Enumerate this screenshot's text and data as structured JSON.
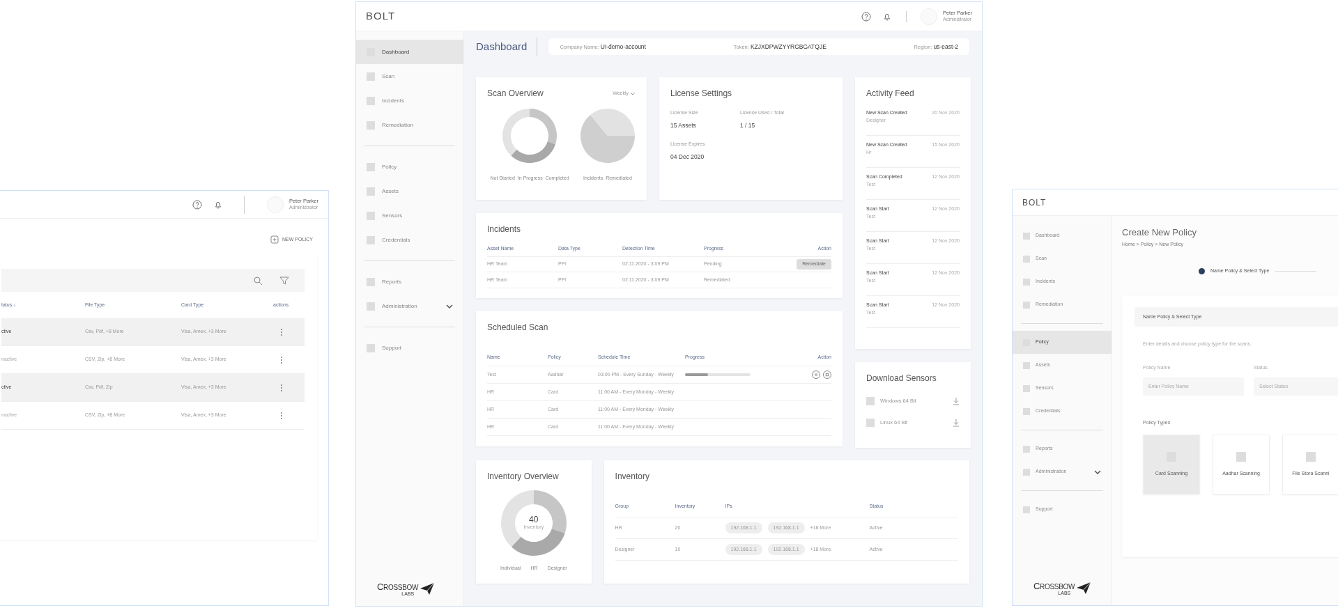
{
  "policy_list_screen": {
    "user": {
      "name": "Peter Parker",
      "role": "Administrator"
    },
    "new_policy_button": "NEW POLICY",
    "table": {
      "columns": [
        "tatus ↓",
        "File Type",
        "Card Type",
        "actions"
      ],
      "rows": [
        {
          "cells": [
            "ctive",
            "Csv, Pdf, +8 More",
            "Visa, Amex, +3 More"
          ],
          "highlighted": true
        },
        {
          "cells": [
            "nactive",
            "CSV, Zip, +8 More",
            "Visa, Amex, +3 More"
          ],
          "highlighted": false
        },
        {
          "cells": [
            "ctive",
            "Csv, Pdf, Zip",
            "Visa, Amex, +3 More"
          ],
          "highlighted": true
        },
        {
          "cells": [
            "nactive",
            "CSV, Zip, +8 More",
            "Visa, Amex, +3 More"
          ],
          "highlighted": false
        }
      ]
    }
  },
  "dashboard_screen": {
    "brand": "BOLT",
    "user": {
      "name": "Peter Parker",
      "role": "Administrator"
    },
    "sidebar": {
      "groups": [
        [
          {
            "label": "Dashboard",
            "selected": true,
            "kind": "link"
          },
          {
            "label": "Scan",
            "selected": false,
            "kind": "link"
          },
          {
            "label": "Incidents",
            "selected": false,
            "kind": "link"
          },
          {
            "label": "Remediation",
            "selected": false,
            "kind": "link"
          }
        ],
        [
          {
            "label": "Policy",
            "selected": false,
            "kind": "link"
          },
          {
            "label": "Assets",
            "selected": false,
            "kind": "link"
          },
          {
            "label": "Sensors",
            "selected": false,
            "kind": "link"
          },
          {
            "label": "Credentials",
            "selected": false,
            "kind": "link"
          }
        ],
        [
          {
            "label": "Reports",
            "selected": false,
            "kind": "link"
          },
          {
            "label": "Administration",
            "selected": false,
            "kind": "submenu"
          }
        ],
        [
          {
            "label": "Support",
            "selected": false,
            "kind": "link"
          }
        ]
      ]
    },
    "logo": {
      "name": "CROSSBOW",
      "sub": "LABS"
    },
    "page_title": "Dashboard",
    "info": [
      "Company Name: **UI-demo-account**",
      "Token: **KZJXDPWZYYRGBGATQJE**",
      "Region: **us-east-2**"
    ],
    "scan_overview": {
      "title": "Scan Overview",
      "period": "Weekly",
      "donut_legend": [
        "Not Started",
        "In Progress",
        "Completed"
      ],
      "pie_legend": [
        "Incidents",
        "Remediated"
      ]
    },
    "license_settings": {
      "title": "License Settings",
      "fields": [
        {
          "label": "License Size",
          "value": "15 Assets"
        },
        {
          "label": "License Used / Total",
          "value": "1 / 15"
        },
        {
          "label": "License Expires",
          "value": "04 Dec 2020"
        }
      ]
    },
    "activity_feed": {
      "title": "Activity Feed",
      "items": [
        {
          "title": "New Scan Created",
          "subtitle": "Designer",
          "date": "20 Nov 2020"
        },
        {
          "title": "New Scan Created",
          "subtitle": "Hr",
          "date": "15 Nov 2020"
        },
        {
          "title": "Scan Completed",
          "subtitle": "Test",
          "date": "12 Nov 2020"
        },
        {
          "title": "Scan Start",
          "subtitle": "Test",
          "date": "12 Nov 2020"
        },
        {
          "title": "Scan Start",
          "subtitle": "Test",
          "date": "12 Nov 2020"
        },
        {
          "title": "Scan Start",
          "subtitle": "Test",
          "date": "12 Nov 2020"
        },
        {
          "title": "Scan Start",
          "subtitle": "Test",
          "date": "12 Nov 2020"
        }
      ]
    },
    "incidents": {
      "title": "Incidents",
      "columns": [
        "Asset Name",
        "Data Type",
        "Detection Time",
        "Progress",
        "Action"
      ],
      "rows": [
        {
          "cells": [
            "HR Team",
            "PPI",
            "02.11.2020 - 3:09 PM",
            "Pending"
          ],
          "action": "Remediate"
        },
        {
          "cells": [
            "HR Team",
            "PPI",
            "02.11.2020 - 3:09 PM",
            "Remediated"
          ]
        }
      ]
    },
    "scheduled_scan": {
      "title": "Scheduled Scan",
      "columns": [
        "Name",
        "Policy",
        "Schedule Time",
        "Progress",
        "Action"
      ],
      "rows": [
        {
          "cells": [
            "Test",
            "Aadhar",
            "03:00 PM - Every Sunday - Weekly"
          ],
          "level": 0.35
        },
        {
          "cells": [
            "HR",
            "Card",
            "11:00 AM - Every Monday - Weekly"
          ]
        },
        {
          "cells": [
            "HR",
            "Card",
            "11:00 AM - Every Monday - Weekly"
          ]
        },
        {
          "cells": [
            "HR",
            "Card",
            "11:00 AM - Every Monday - Weekly"
          ]
        }
      ]
    },
    "download_sensors": {
      "title": "Download Sensors",
      "items": [
        "Windows 64 Bit",
        "Linux 64 Bit"
      ]
    },
    "inventory_overview": {
      "title": "Inventory Overview",
      "total": "40",
      "total_label": "Inventory",
      "legend": [
        "Individual",
        "HR",
        "Designer"
      ]
    },
    "inventory": {
      "title": "Inventory",
      "columns": [
        "Group",
        "Inventory",
        "IPs",
        "Status"
      ],
      "rows": [
        {
          "group": "HR",
          "count": "20",
          "ips": [
            "192.168.1.1",
            "192.168.1.1"
          ],
          "more": "+18 More",
          "status": "Active"
        },
        {
          "group": "Designer",
          "count": "10",
          "ips": [
            "192.168.1.1",
            "192.168.1.1"
          ],
          "more": "+18 More",
          "status": "Active"
        }
      ]
    }
  },
  "create_policy_screen": {
    "brand": "BOLT",
    "sidebar": {
      "groups": [
        [
          {
            "label": "Dashboard",
            "selected": false,
            "kind": "link"
          },
          {
            "label": "Scan",
            "selected": false,
            "kind": "link"
          },
          {
            "label": "Incidents",
            "selected": false,
            "kind": "link"
          },
          {
            "label": "Remediation",
            "selected": false,
            "kind": "link"
          }
        ],
        [
          {
            "label": "Policy",
            "selected": true,
            "kind": "link"
          },
          {
            "label": "Assets",
            "selected": false,
            "kind": "link"
          },
          {
            "label": "Sensors",
            "selected": false,
            "kind": "link"
          },
          {
            "label": "Credentials",
            "selected": false,
            "kind": "link"
          }
        ],
        [
          {
            "label": "Reports",
            "selected": false,
            "kind": "link"
          },
          {
            "label": "Administration",
            "selected": false,
            "kind": "submenu"
          }
        ],
        [
          {
            "label": "Support",
            "selected": false,
            "kind": "link"
          }
        ]
      ]
    },
    "logo": {
      "name": "CROSSBOW",
      "sub": "LABS"
    },
    "page_title": "Create New Policy",
    "breadcrumb": "Home > Policy > New Policy",
    "step": "Name Policy & Select Type",
    "section_title": "Name Policy & Select Type",
    "description": "Enter details and choose policy type for the scans.",
    "fields": [
      {
        "label": "Policy Name",
        "placeholder": "Enter Policy Name"
      },
      {
        "label": "Status",
        "placeholder": "Select Status"
      }
    ],
    "policy_types_label": "Policy Types",
    "policy_types": [
      {
        "label": "Card Scanning",
        "selected": true
      },
      {
        "label": "Aadhar Scanning",
        "selected": false
      },
      {
        "label": "File Stora Scanni",
        "selected": false
      }
    ]
  }
}
